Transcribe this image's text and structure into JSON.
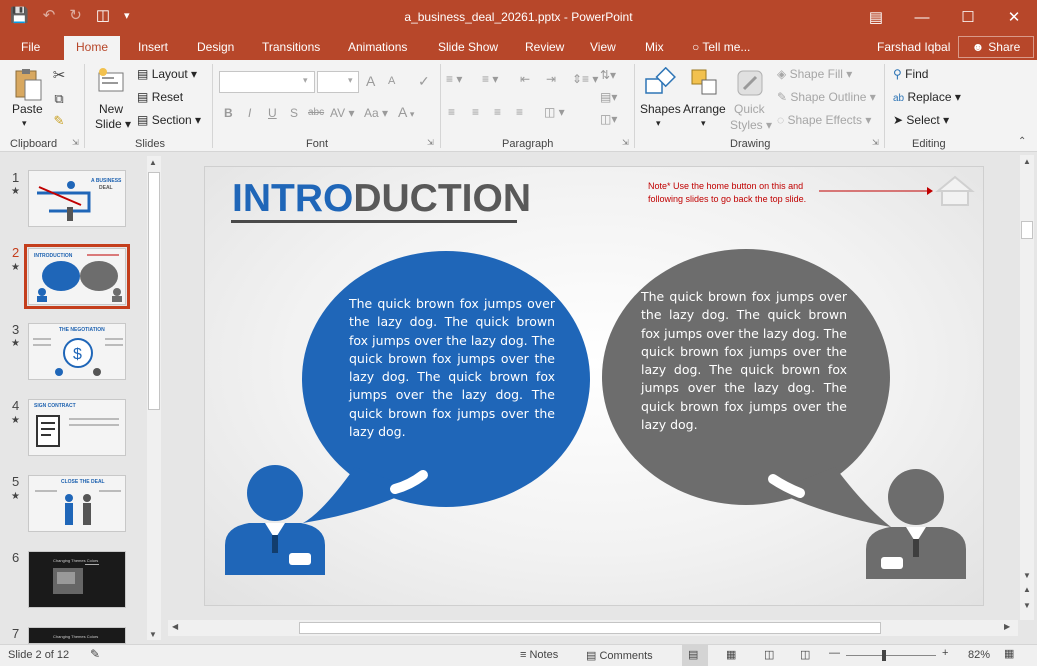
{
  "window": {
    "title": "a_business_deal_20261.pptx - PowerPoint",
    "controls": [
      "ribbon-display-icon",
      "minimize-icon",
      "maximize-icon",
      "close-icon"
    ]
  },
  "quick_access": [
    "save-icon",
    "undo-icon",
    "redo-icon",
    "present-icon",
    "customize-icon"
  ],
  "tabs": [
    "File",
    "Home",
    "Insert",
    "Design",
    "Transitions",
    "Animations",
    "Slide Show",
    "Review",
    "View",
    "Mix"
  ],
  "active_tab": "Home",
  "tell_me": "Tell me...",
  "user": "Farshad Iqbal",
  "share": "Share",
  "ribbon": {
    "clipboard": {
      "paste": "Paste",
      "label": "Clipboard"
    },
    "slides": {
      "new_slide_1": "New",
      "new_slide_2": "Slide",
      "layout": "Layout",
      "reset": "Reset",
      "section": "Section",
      "label": "Slides"
    },
    "font": {
      "label": "Font",
      "bold": "B",
      "italic": "I",
      "underline": "U",
      "shadow": "S",
      "strike": "abc",
      "spacing": "AV",
      "case": "Aa",
      "grow": "A",
      "shrink": "A"
    },
    "paragraph": {
      "label": "Paragraph"
    },
    "drawing": {
      "shapes": "Shapes",
      "arrange": "Arrange",
      "quick_styles_1": "Quick",
      "quick_styles_2": "Styles",
      "shape_fill": "Shape Fill",
      "shape_outline": "Shape Outline",
      "shape_effects": "Shape Effects",
      "label": "Drawing"
    },
    "editing": {
      "find": "Find",
      "replace": "Replace",
      "select": "Select",
      "label": "Editing"
    }
  },
  "thumbnails": [
    {
      "num": "1",
      "caption_1": "A BUSINESS",
      "caption_2": "DEAL"
    },
    {
      "num": "2",
      "caption_1": "INTRODUCTION"
    },
    {
      "num": "3",
      "caption_1": "THE NEGOTIATION"
    },
    {
      "num": "4",
      "caption_1": "SIGN CONTRACT"
    },
    {
      "num": "5",
      "caption_1": "CLOSE THE DEAL"
    },
    {
      "num": "6",
      "caption_1": "Changing Themes Colors"
    },
    {
      "num": "7",
      "caption_1": "Changing Themes Colors"
    }
  ],
  "slide": {
    "title_blue": "INTRO",
    "title_grey": "DUCTION",
    "note": "Note*  Use the home button on this and following slides to go back the top slide.",
    "left_bubble": "The quick brown fox jumps over the lazy dog.  The quick brown fox jumps over the lazy dog.  The quick brown fox jumps over the lazy dog. The quick brown fox jumps over the lazy dog. The quick brown fox jumps over the lazy dog.",
    "right_bubble": "The quick brown fox jumps over the lazy dog.  The quick brown fox jumps over the lazy dog.  The quick brown fox jumps over the lazy dog. The quick brown fox jumps over the lazy dog. The quick brown fox jumps over the lazy dog."
  },
  "status": {
    "slide_count": "Slide 2 of 12",
    "notes": "Notes",
    "comments": "Comments",
    "zoom": "82%"
  },
  "colors": {
    "accent": "#b7472a",
    "blue": "#1f66b8",
    "grey": "#6d6d6d"
  }
}
